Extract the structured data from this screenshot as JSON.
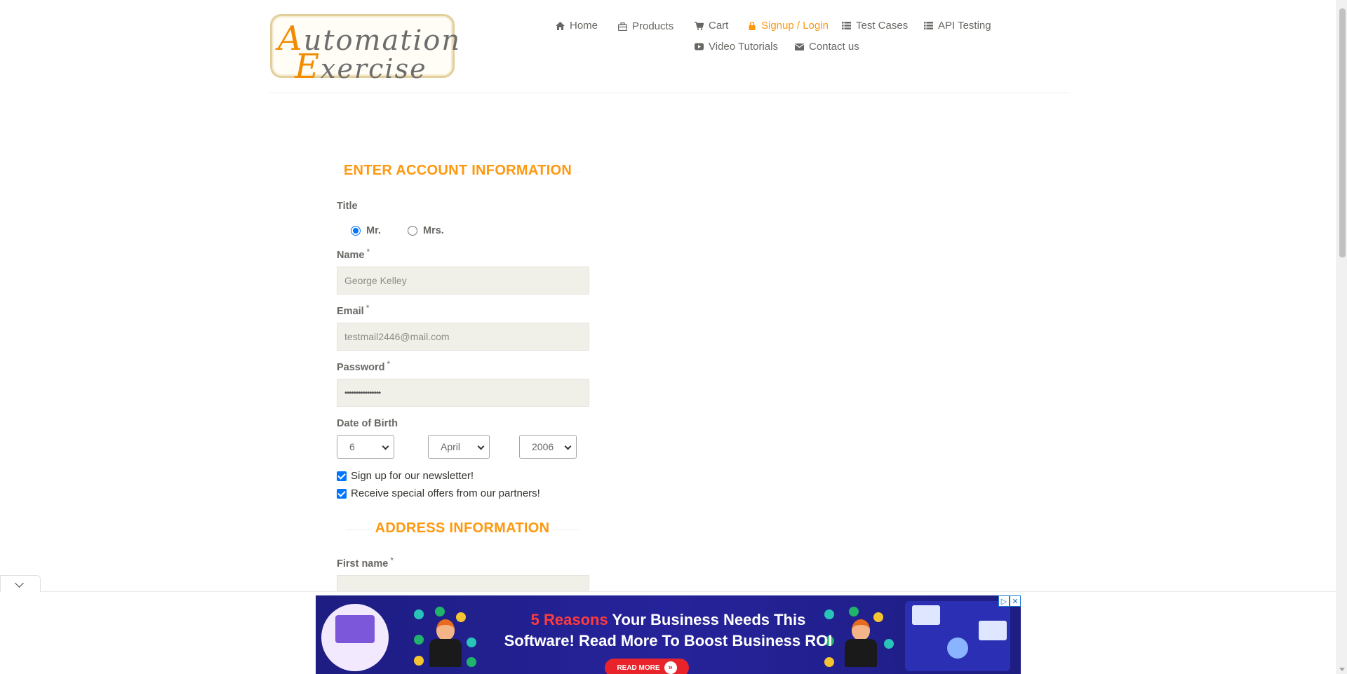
{
  "header": {
    "logo_line1_cap": "A",
    "logo_line1_rest": "utomation",
    "logo_line2_cap": "E",
    "logo_line2_rest": "xercise",
    "nav": [
      {
        "label": "Home",
        "icon": "home-icon"
      },
      {
        "label": "Products",
        "icon": "briefcase-icon"
      },
      {
        "label": "Cart",
        "icon": "cart-icon"
      },
      {
        "label": "Signup / Login",
        "icon": "lock-icon",
        "active": true
      },
      {
        "label": "Test Cases",
        "icon": "list-icon"
      },
      {
        "label": "API Testing",
        "icon": "list-icon"
      },
      {
        "label": "Video Tutorials",
        "icon": "youtube-icon"
      },
      {
        "label": "Contact us",
        "icon": "envelope-icon"
      }
    ]
  },
  "account": {
    "heading": "ENTER ACCOUNT INFORMATION",
    "title_label": "Title",
    "title_options": [
      "Mr.",
      "Mrs."
    ],
    "title_selected": "Mr.",
    "name_label": "Name",
    "name_value": "George Kelley",
    "email_label": "Email",
    "email_value": "testmail2446@mail.com",
    "password_label": "Password",
    "password_value": "••••••••••••••••",
    "dob_label": "Date of Birth",
    "dob_day": "6",
    "dob_month": "April",
    "dob_year": "2006",
    "newsletter_label": "Sign up for our newsletter!",
    "offers_label": "Receive special offers from our partners!",
    "required_mark": "*"
  },
  "address": {
    "heading": "ADDRESS INFORMATION",
    "first_name_label": "First name"
  },
  "ad": {
    "headline_highlight": "5 Reasons",
    "headline_rest": " Your Business Needs This",
    "headline_line2": "Software! Read More To Boost Business ROI",
    "cta": "READ MORE",
    "colors": {
      "background": "#1d1d82",
      "cta": "#e8242a",
      "highlight": "#ff3b3b"
    }
  },
  "colors": {
    "accent": "#fe980f",
    "text": "#696763",
    "input_bg": "#f0f0e9",
    "radio_checkbox": "#0075ff"
  }
}
